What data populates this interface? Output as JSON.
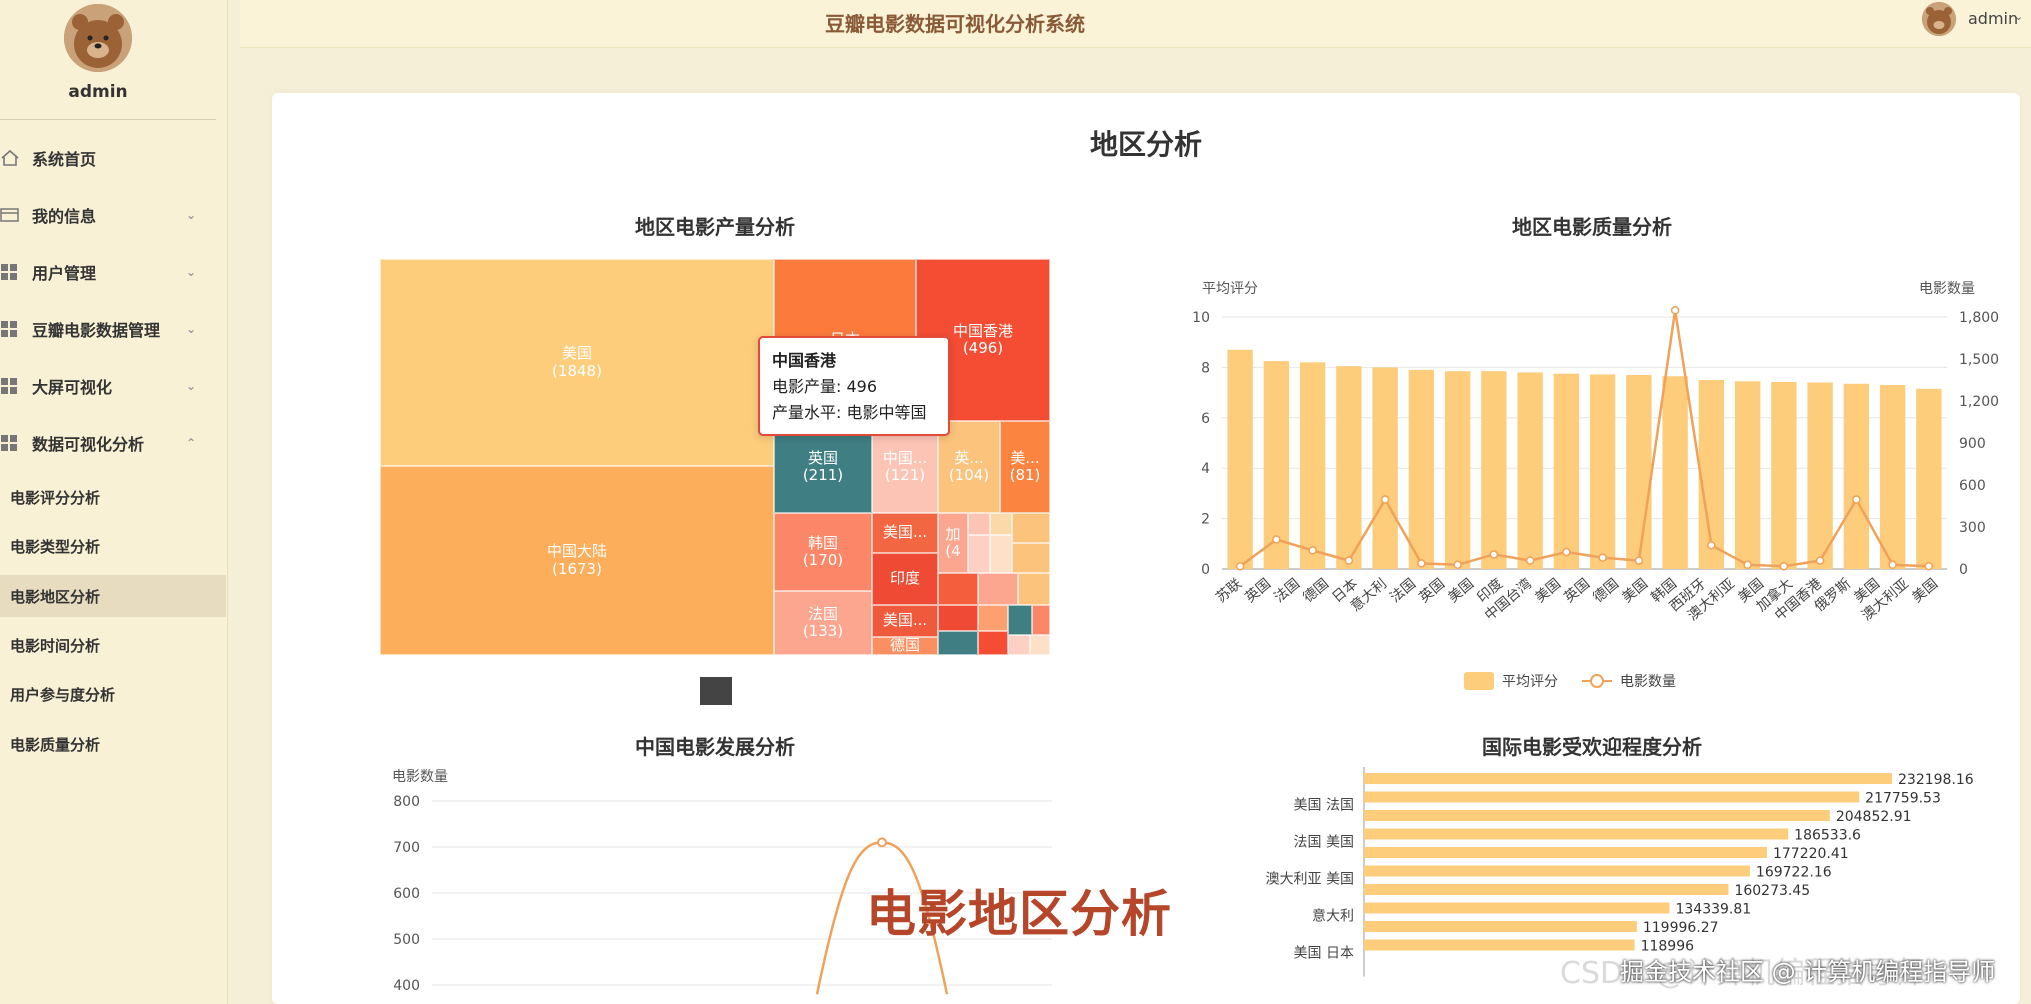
{
  "app": {
    "title": "豆瓣电影数据可视化分析系统"
  },
  "user": {
    "name": "admin"
  },
  "sidebar": {
    "menu": [
      {
        "label": "系统首页",
        "icon": "home-icon",
        "chevron": false
      },
      {
        "label": "我的信息",
        "icon": "card-icon",
        "chevron": "down"
      },
      {
        "label": "用户管理",
        "icon": "grid-icon",
        "chevron": "down"
      },
      {
        "label": "豆瓣电影数据管理",
        "icon": "grid-icon",
        "chevron": "down"
      },
      {
        "label": "大屏可视化",
        "icon": "grid-icon",
        "chevron": "down"
      },
      {
        "label": "数据可视化分析",
        "icon": "grid-icon",
        "chevron": "up"
      }
    ],
    "submenu": [
      {
        "label": "电影评分分析"
      },
      {
        "label": "电影类型分析"
      },
      {
        "label": "电影地区分析",
        "active": true
      },
      {
        "label": "电影时间分析"
      },
      {
        "label": "用户参与度分析"
      },
      {
        "label": "电影质量分析"
      }
    ]
  },
  "page": {
    "title": "地区分析"
  },
  "colors": {
    "accent": "#8a5a38",
    "bar": "#fdcd7c",
    "line": "#f0a25a",
    "tooltip_border": "#e24a3a"
  },
  "treemap": {
    "title": "地区电影产量分析",
    "cells": [
      {
        "label": "美国",
        "value": "(1848)"
      },
      {
        "label": "中国大陆",
        "value": "(1673)"
      },
      {
        "label": "日本",
        "value": ""
      },
      {
        "label": "中国香港",
        "value": "(496)"
      },
      {
        "label": "英国",
        "value": "(211)"
      },
      {
        "label": "中国...",
        "value": "(121)"
      },
      {
        "label": "英...",
        "value": "(104)"
      },
      {
        "label": "美...",
        "value": "(81)"
      },
      {
        "label": "美国...",
        "value": ""
      },
      {
        "label": "加",
        "value": "(4"
      },
      {
        "label": "韩国",
        "value": "(170)"
      },
      {
        "label": "印度",
        "value": ""
      },
      {
        "label": "美国...",
        "value": ""
      },
      {
        "label": "法国",
        "value": "(133)"
      },
      {
        "label": "德国",
        "value": ""
      }
    ],
    "tooltip": {
      "title": "中国香港",
      "line1": "电影产量: 496",
      "line2": "产量水平: 电影中等国"
    }
  },
  "quality": {
    "title": "地区电影质量分析",
    "y_left_label": "平均评分",
    "y_right_label": "电影数量",
    "legend": [
      "平均评分",
      "电影数量"
    ]
  },
  "development": {
    "title": "中国电影发展分析",
    "y_label": "电影数量"
  },
  "popularity": {
    "title": "国际电影受欢迎程度分析"
  },
  "chart_data": [
    {
      "type": "bar",
      "title": "地区电影质量分析",
      "ylabel": "平均评分",
      "y2label": "电影数量",
      "ylim": [
        0,
        10
      ],
      "y2lim": [
        0,
        1800
      ],
      "categories": [
        "苏联",
        "英国",
        "法国",
        "德国",
        "日本",
        "意大利",
        "法国 美国",
        "英国 美国",
        "印度",
        "中国台湾",
        "美国 英国",
        "英国 德国",
        "美国",
        "韩国",
        "西班牙",
        "澳大利亚 美国",
        "加拿大 美国",
        "中国香港",
        "俄罗斯",
        "美国 澳大利亚"
      ],
      "series": [
        {
          "name": "平均评分",
          "type": "bar",
          "values": [
            8.7,
            8.25,
            8.2,
            8.05,
            8.0,
            7.9,
            7.85,
            7.85,
            7.8,
            7.75,
            7.72,
            7.7,
            7.65,
            7.5,
            7.45,
            7.42,
            7.4,
            7.35,
            7.3,
            7.15
          ]
        },
        {
          "name": "电影数量",
          "type": "line",
          "values": [
            20,
            211,
            133,
            60,
            496,
            40,
            30,
            104,
            60,
            121,
            81,
            60,
            1848,
            170,
            30,
            20,
            60,
            496,
            30,
            20
          ]
        }
      ],
      "x_tick_labels": [
        "苏联",
        "英国",
        "法国",
        "德国",
        "日本",
        "意大利",
        "法国",
        "英国",
        "美国",
        "印度",
        "中国台湾",
        "美国",
        "英国",
        "德国",
        "美国",
        "韩国",
        "西班牙",
        "澳大利亚",
        "美国",
        "加拿大",
        "中国香港",
        "俄罗斯",
        "美国",
        "澳大利亚",
        "美国"
      ],
      "y_ticks": [
        "0",
        "2",
        "4",
        "6",
        "8",
        "10"
      ],
      "y2_ticks": [
        "0",
        "300",
        "600",
        "900",
        "1,200",
        "1,500",
        "1,800"
      ]
    },
    {
      "type": "line",
      "title": "中国电影发展分析",
      "ylabel": "电影数量",
      "ylim": [
        400,
        800
      ],
      "y_ticks": [
        "400",
        "500",
        "600",
        "700",
        "800"
      ],
      "series": [
        {
          "values": [
            380,
            710,
            380
          ]
        }
      ]
    },
    {
      "type": "bar",
      "orientation": "horizontal",
      "title": "国际电影受欢迎程度分析",
      "categories": [
        "",
        "美国 法国",
        "",
        "法国 美国",
        "",
        "澳大利亚 美国",
        "",
        "意大利",
        "",
        "美国 日本",
        ""
      ],
      "values": [
        232198.16,
        217759.53,
        204852.91,
        186533.6,
        177220.41,
        169722.16,
        160273.45,
        134339.81,
        119996.27,
        118996,
        0
      ],
      "value_labels": [
        "232198.16",
        "217759.53",
        "204852.91",
        "186533.6",
        "177220.41",
        "169722.16",
        "160273.45",
        "134339.81",
        "119996.27",
        "118996"
      ]
    }
  ],
  "watermarks": {
    "big": "电影地区分析",
    "csdn": "CSDN @计算机编程指导师",
    "juejin": "掘金技术社区 @ 计算机编程指导师"
  }
}
